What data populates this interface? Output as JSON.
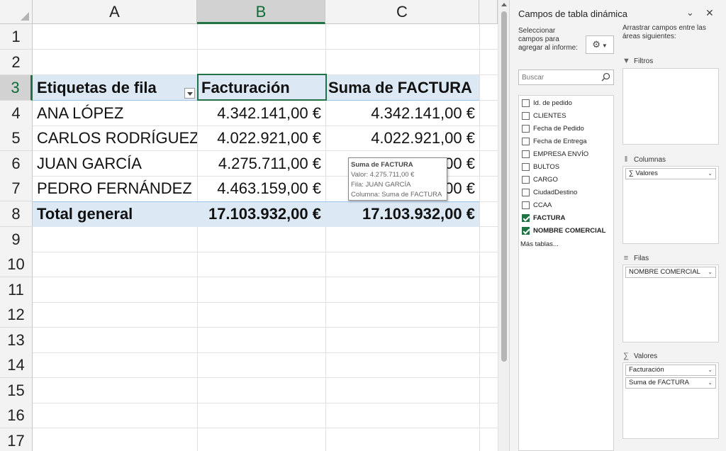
{
  "sheet": {
    "columns": [
      "A",
      "B",
      "C"
    ],
    "rows": [
      "1",
      "2",
      "3",
      "4",
      "5",
      "6",
      "7",
      "8",
      "9",
      "10",
      "11",
      "12",
      "13",
      "14",
      "15",
      "16",
      "17"
    ],
    "header": {
      "row_labels": "Etiquetas de fila",
      "col_b": "Facturación",
      "col_c": "Suma de FACTURA"
    },
    "data_rows": [
      {
        "name": "ANA LÓPEZ",
        "b": "4.342.141,00 €",
        "c": "4.342.141,00 €"
      },
      {
        "name": "CARLOS RODRÍGUEZ",
        "b": "4.022.921,00 €",
        "c": "4.022.921,00 €"
      },
      {
        "name": "JUAN GARCÍA",
        "b": "4.275.711,00 €",
        "c": "4.275.711,00 €"
      },
      {
        "name": "PEDRO FERNÁNDEZ",
        "b": "4.463.159,00 €",
        "c": "4.463.159,00 €"
      }
    ],
    "total": {
      "label": "Total general",
      "b": "17.103.932,00 €",
      "c": "17.103.932,00 €"
    },
    "tooltip": {
      "title": "Suma de FACTURA",
      "line1": "Valor: 4.275.711,00 €",
      "line2": "Fila: JUAN GARCÍA",
      "line3": "Columna: Suma de FACTURA"
    }
  },
  "panel": {
    "title": "Campos de tabla dinámica",
    "choose_fields": "Seleccionar campos para agregar al informe:",
    "search_placeholder": "Buscar",
    "fields": [
      {
        "label": "Id. de pedido",
        "checked": false
      },
      {
        "label": "CLIENTES",
        "checked": false
      },
      {
        "label": "Fecha de Pedido",
        "checked": false
      },
      {
        "label": "Fecha de Entrega",
        "checked": false
      },
      {
        "label": "EMPRESA ENVÍO",
        "checked": false
      },
      {
        "label": "BULTOS",
        "checked": false
      },
      {
        "label": "CARGO",
        "checked": false
      },
      {
        "label": "CiudadDestino",
        "checked": false
      },
      {
        "label": "CCAA",
        "checked": false
      },
      {
        "label": "FACTURA",
        "checked": true
      },
      {
        "label": "NOMBRE COMERCIAL",
        "checked": true
      }
    ],
    "more_tables": "Más tablas...",
    "drag_hint": "Arrastrar campos entre las áreas siguientes:",
    "areas": {
      "filters": "Filtros",
      "columns": "Columnas",
      "columns_items": [
        "∑ Valores"
      ],
      "rows": "Filas",
      "rows_items": [
        "NOMBRE COMERCIAL"
      ],
      "values": "Valores",
      "values_items": [
        "Facturación",
        "Suma de FACTURA"
      ]
    }
  }
}
